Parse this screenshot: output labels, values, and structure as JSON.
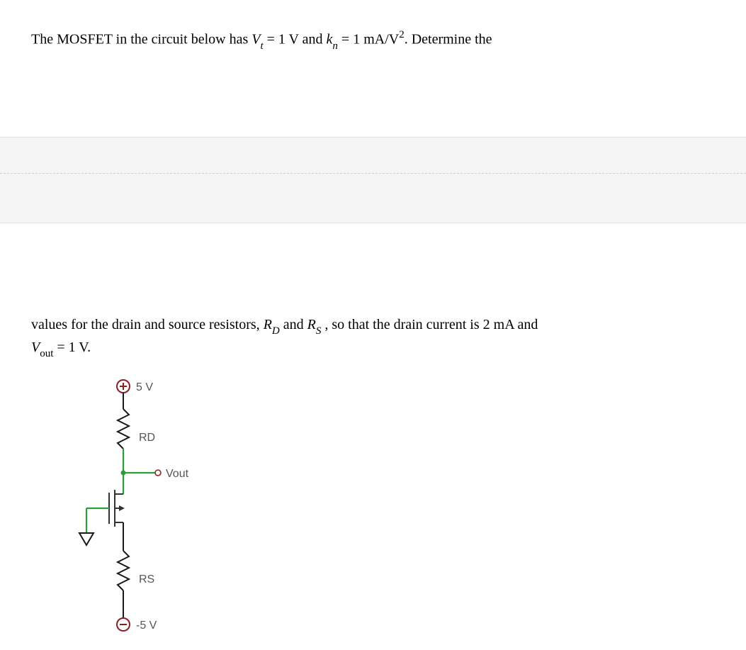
{
  "problem": {
    "line1_prefix": "The MOSFET in the circuit below has ",
    "Vt_sym": "V",
    "Vt_sub": "t",
    "eq1": " = 1 V and ",
    "kn_sym": "k",
    "kn_sub": "n",
    "eq2": " = 1 mA/V",
    "sq": "2",
    "line1_suffix": ".  Determine the",
    "line2_prefix": "values for the drain and source resistors, ",
    "RD_sym": "R",
    "RD_sub": "D",
    "and_word": " and ",
    "RS_sym": "R",
    "RS_sub": "S",
    "line2_mid": ", so that the drain current is 2 mA and",
    "Vout_sym": "V",
    "Vout_sub": "out",
    "line3_rest": " = 1 V."
  },
  "circuit": {
    "vdd": "5 V",
    "vss": "-5 V",
    "rd_label": "RD",
    "rs_label": "RS",
    "vout_label": "Vout"
  }
}
